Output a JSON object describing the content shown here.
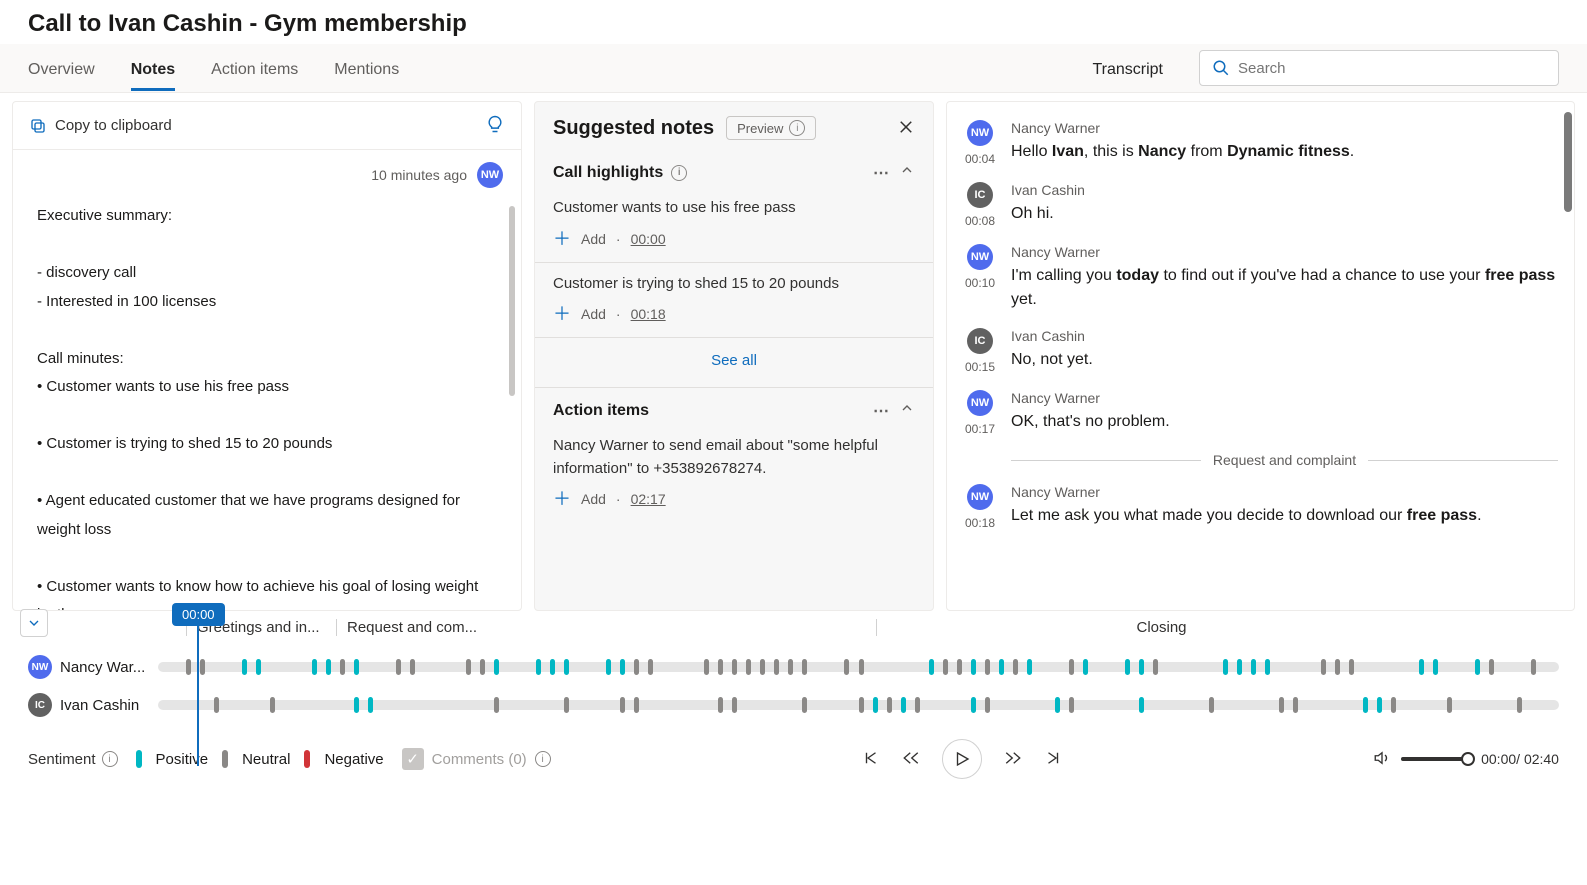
{
  "page_title": "Call to Ivan Cashin - Gym membership",
  "tabs": {
    "overview": "Overview",
    "notes": "Notes",
    "action_items": "Action items",
    "mentions": "Mentions"
  },
  "transcript_label": "Transcript",
  "search_placeholder": "Search",
  "notes_panel": {
    "copy_label": "Copy to clipboard",
    "timestamp": "10 minutes ago",
    "author_initials": "NW",
    "body_heading1": "Executive summary:",
    "body_b1": "- discovery call",
    "body_b2": "- Interested in 100 licenses",
    "body_heading2": "Call minutes:",
    "body_m1": "• Customer wants to use his free pass",
    "body_m2": "• Customer is trying to shed 15 to 20 pounds",
    "body_m3": "• Agent educated customer that we have programs designed for weight loss",
    "body_m4": "• Customer wants to know how to achieve his goal of losing weight by the summer"
  },
  "suggested": {
    "title": "Suggested notes",
    "preview": "Preview",
    "highlights_title": "Call highlights",
    "items": [
      {
        "text": "Customer wants to use his free pass",
        "ts": "00:00"
      },
      {
        "text": "Customer is trying to shed 15 to 20 pounds",
        "ts": "00:18"
      }
    ],
    "add_label": "Add",
    "see_all": "See all",
    "action_title": "Action items",
    "action_text": "Nancy Warner to send email about \"some helpful information\" to +353892678274.",
    "action_ts": "02:17"
  },
  "transcript": {
    "entries": [
      {
        "initials": "NW",
        "cls": "nw",
        "name": "Nancy Warner",
        "time": "00:04",
        "html": "Hello <b>Ivan</b>, this is <b>Nancy</b> from <b>Dynamic fitness</b>."
      },
      {
        "initials": "IC",
        "cls": "ic",
        "name": "Ivan Cashin",
        "time": "00:08",
        "html": "Oh hi."
      },
      {
        "initials": "NW",
        "cls": "nw",
        "name": "Nancy Warner",
        "time": "00:10",
        "html": "I'm calling you <b>today</b> to find out if you've had a chance to use your <b>free pass</b> yet."
      },
      {
        "initials": "IC",
        "cls": "ic",
        "name": "Ivan Cashin",
        "time": "00:15",
        "html": "No, not yet."
      },
      {
        "initials": "NW",
        "cls": "nw",
        "name": "Nancy Warner",
        "time": "00:17",
        "html": "OK, that's no problem."
      }
    ],
    "divider": "Request and complaint",
    "entry_after": {
      "initials": "NW",
      "cls": "nw",
      "name": "Nancy Warner",
      "time": "00:18",
      "html": "Let me ask you what made you decide to download our <b>free pass</b>."
    }
  },
  "timeline": {
    "marker_time": "00:00",
    "seg1": "Greetings and in...",
    "seg2": "Request and com...",
    "seg3": "Closing",
    "speaker1": {
      "initials": "NW",
      "name": "Nancy War..."
    },
    "speaker2": {
      "initials": "IC",
      "name": "Ivan Cashin"
    }
  },
  "footer": {
    "sentiment": "Sentiment",
    "pos": "Positive",
    "neu": "Neutral",
    "neg": "Negative",
    "comments": "Comments (0)",
    "cur": "00:00",
    "dur": "02:40"
  }
}
